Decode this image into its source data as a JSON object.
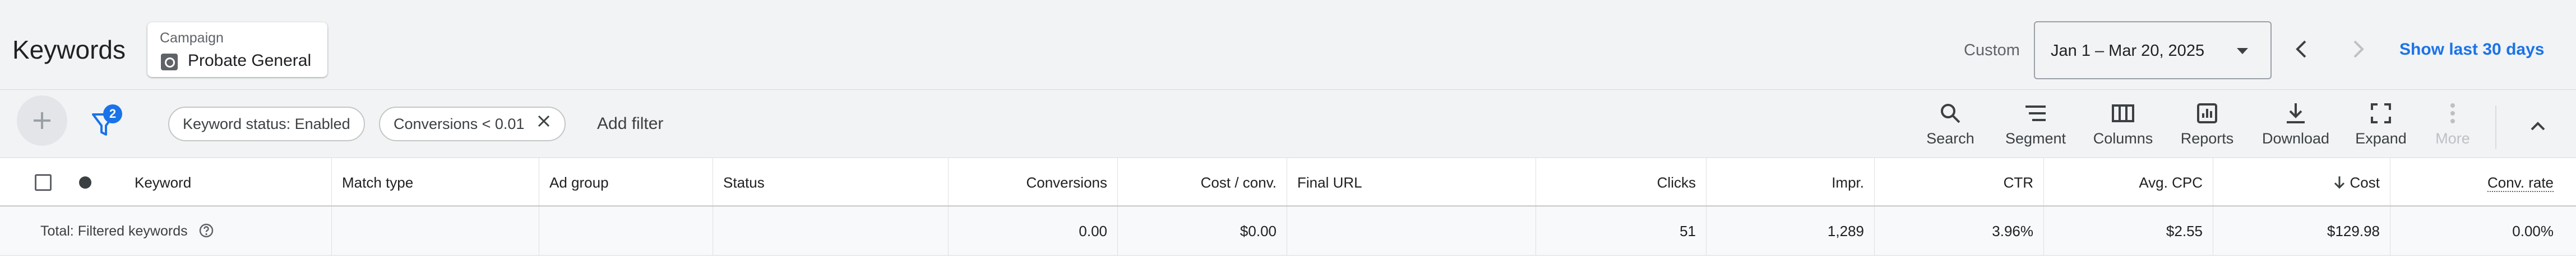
{
  "header": {
    "title": "Keywords",
    "campaign_label": "Campaign",
    "campaign_name": "Probate General",
    "date_mode": "Custom",
    "date_range": "Jan 1 – Mar 20, 2025",
    "show_last": "Show last 30 days"
  },
  "toolbar": {
    "filter_count": "2",
    "filters": [
      "Keyword status: Enabled",
      "Conversions < 0.01"
    ],
    "add_filter": "Add filter",
    "tools": {
      "search": "Search",
      "segment": "Segment",
      "columns": "Columns",
      "reports": "Reports",
      "download": "Download",
      "expand": "Expand",
      "more": "More"
    }
  },
  "table": {
    "columns": {
      "keyword": "Keyword",
      "match_type": "Match type",
      "ad_group": "Ad group",
      "status": "Status",
      "conversions": "Conversions",
      "cost_conv": "Cost / conv.",
      "final_url": "Final URL",
      "clicks": "Clicks",
      "impr": "Impr.",
      "ctr": "CTR",
      "avg_cpc": "Avg. CPC",
      "cost": "Cost",
      "conv_rate": "Conv. rate"
    },
    "total_row": {
      "label": "Total: Filtered keywords",
      "conversions": "0.00",
      "cost_conv": "$0.00",
      "clicks": "51",
      "impr": "1,289",
      "ctr": "3.96%",
      "avg_cpc": "$2.55",
      "cost": "$129.98",
      "conv_rate": "0.00%"
    }
  },
  "colors": {
    "accent": "#1a73e8",
    "background": "#f1f3f4",
    "text": "#202124",
    "muted": "#5f6368"
  }
}
